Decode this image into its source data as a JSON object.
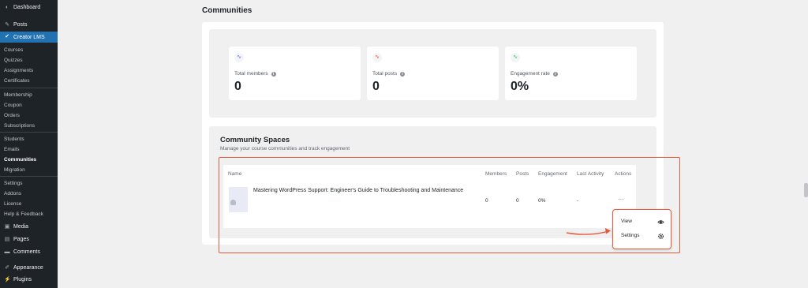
{
  "sidebar": {
    "dashboard": "Dashboard",
    "posts": "Posts",
    "creator_lms": "Creator LMS",
    "sub_items": [
      "Courses",
      "Quizzes",
      "Assignments",
      "Certificates",
      "Membership",
      "Coupon",
      "Orders",
      "Subscriptions",
      "Students",
      "Emails",
      "Communities",
      "Migration",
      "Settings",
      "Addons",
      "License",
      "Help & Feedback"
    ],
    "media": "Media",
    "pages": "Pages",
    "comments": "Comments",
    "appearance": "Appearance",
    "plugins": "Plugins"
  },
  "page": {
    "title": "Communities"
  },
  "stats": [
    {
      "label": "Total members",
      "value": "0",
      "color": "#6366f1"
    },
    {
      "label": "Total posts",
      "value": "0",
      "color": "#ef4444"
    },
    {
      "label": "Engagement rate",
      "value": "0%",
      "color": "#22c55e"
    }
  ],
  "spaces": {
    "title": "Community Spaces",
    "subtitle": "Manage your course communities and track engagement",
    "columns": [
      "Name",
      "Members",
      "Posts",
      "Engagement",
      "Last Activity",
      "Actions"
    ],
    "row": {
      "name": "Mastering WordPress Support: Engineer's Guide to Troubleshooting and Maintenance",
      "members": "0",
      "posts": "0",
      "engagement": "0%",
      "last_activity": "-",
      "actions": "···"
    },
    "menu": [
      {
        "label": "View",
        "icon": "eye-icon"
      },
      {
        "label": "Settings",
        "icon": "gear-icon"
      }
    ]
  },
  "colors": {
    "accent": "#2271b1",
    "highlight": "#e45a3b",
    "sidebar": "#1d2327"
  }
}
